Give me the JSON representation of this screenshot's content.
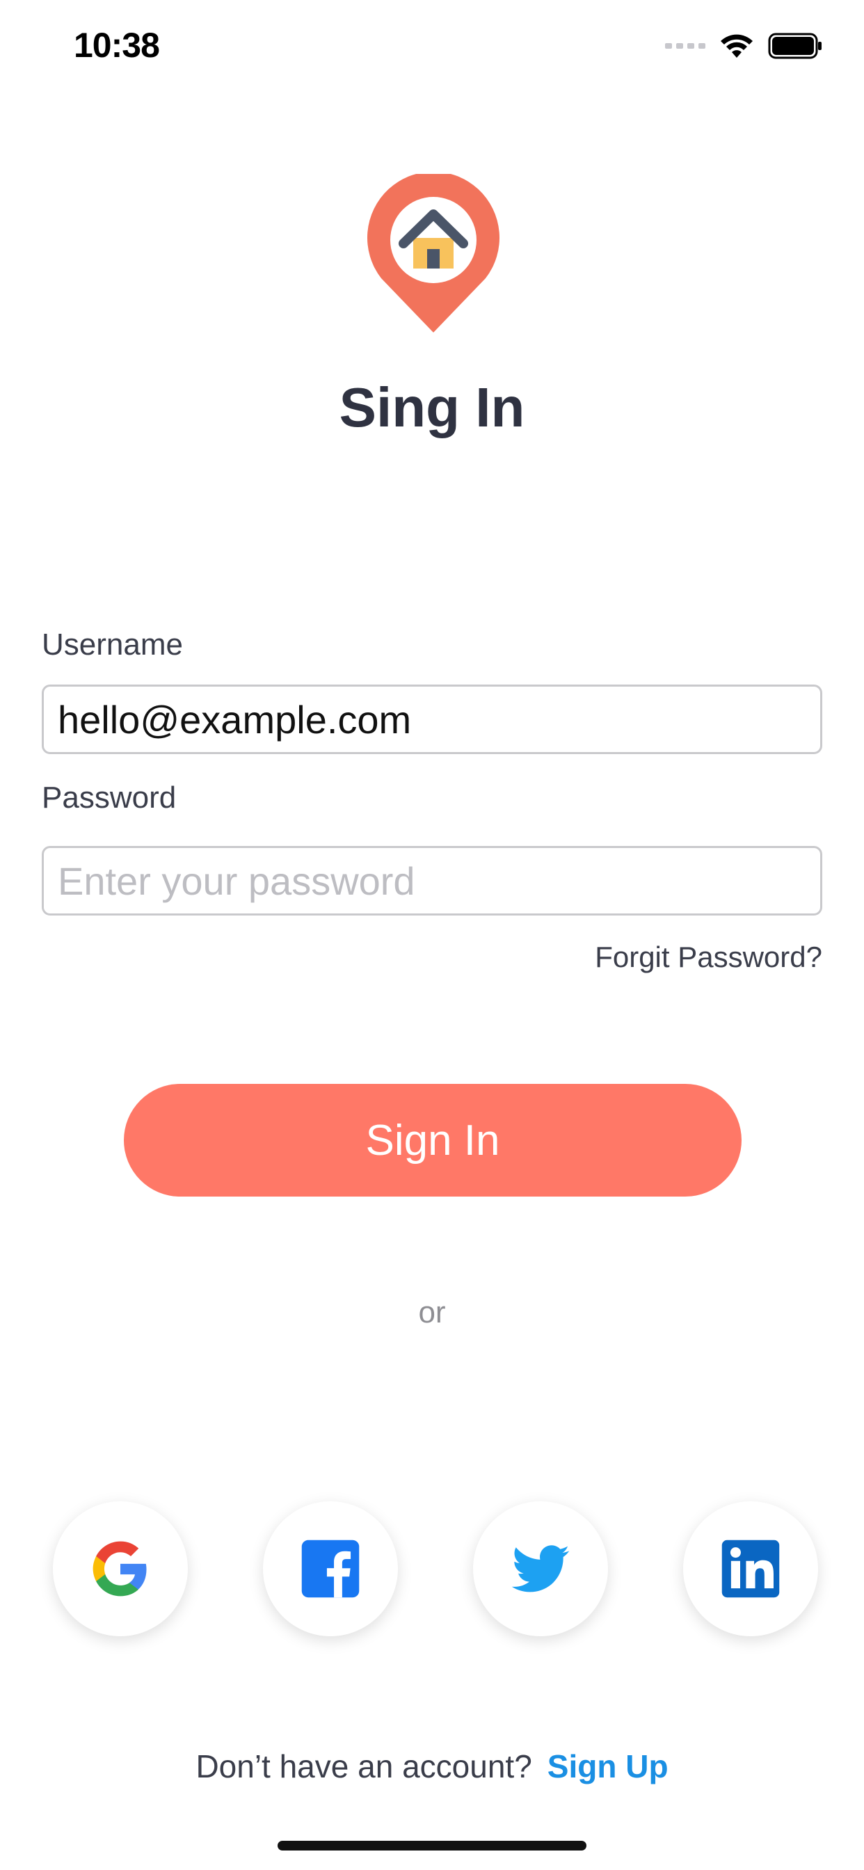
{
  "status_bar": {
    "time": "10:38",
    "icons": [
      "signal-icon",
      "wifi-icon",
      "battery-icon"
    ]
  },
  "logo": {
    "icon": "home-location-pin-icon",
    "pin_color": "#f2735b",
    "roof_color": "#4a5568",
    "house_color": "#f8c25c"
  },
  "title": "Sing In",
  "form": {
    "username_label": "Username",
    "username_value": "hello@example.com",
    "password_label": "Password",
    "password_placeholder": "Enter your password",
    "forgot_label": "Forgit Password?"
  },
  "signin_button": {
    "label": "Sign In",
    "color": "#ff7867"
  },
  "divider_text": "or",
  "social_buttons": [
    {
      "name": "google",
      "icon": "google-icon"
    },
    {
      "name": "facebook",
      "icon": "facebook-icon",
      "color": "#1877f2"
    },
    {
      "name": "twitter",
      "icon": "twitter-icon",
      "color": "#1da1f2"
    },
    {
      "name": "linkedin",
      "icon": "linkedin-icon",
      "color": "#0a66c2"
    }
  ],
  "footer": {
    "question": "Don’t have an account?",
    "signup_label": "Sign Up",
    "link_color": "#1a8fe3"
  }
}
